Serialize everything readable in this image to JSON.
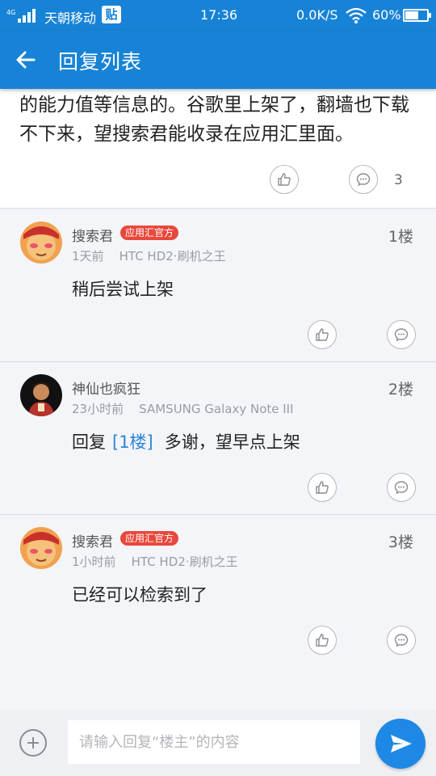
{
  "status_bar": {
    "carrier": "天朝移动",
    "tieba_icon": "贴",
    "time": "17:36",
    "net_speed": "0.0K/S",
    "battery": "60%"
  },
  "header": {
    "title": "回复列表"
  },
  "main_post": {
    "text": "的能力值等信息的。谷歌里上架了，翻墙也下载不下来，望搜索君能收录在应用汇里面。",
    "reply_count": "3"
  },
  "replies": [
    {
      "username": "搜索君",
      "badge": "应用汇官方",
      "time": "1天前",
      "device": "HTC HD2·刷机之王",
      "floor": "1楼",
      "content": "稍后尝试上架"
    },
    {
      "username": "神仙也疯狂",
      "time": "23小时前",
      "device": "SAMSUNG Galaxy Note III",
      "floor": "2楼",
      "prefix": "回复",
      "ref": "[1楼]",
      "content": "多谢，望早点上架"
    },
    {
      "username": "搜索君",
      "badge": "应用汇官方",
      "time": "1小时前",
      "device": "HTC HD2·刷机之王",
      "floor": "3楼",
      "content": "已经可以检索到了"
    }
  ],
  "input": {
    "placeholder": "请输入回复“楼主”的内容"
  },
  "colors": {
    "primary": "#1783d6",
    "badge": "#e9483c",
    "link": "#2e86d9",
    "send": "#1e88e5"
  },
  "icons": [
    "back-arrow-icon",
    "like-icon",
    "comment-icon",
    "add-icon",
    "send-icon"
  ]
}
